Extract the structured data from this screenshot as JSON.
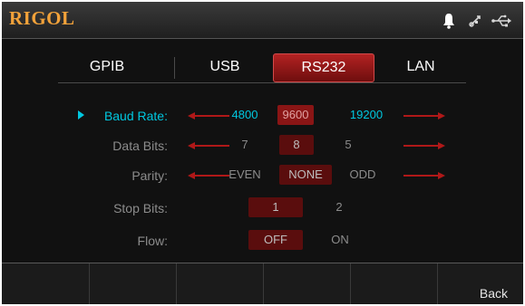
{
  "header": {
    "logo": "RIGOL",
    "icons": [
      "bell-icon",
      "usb-device-icon",
      "usb-icon"
    ]
  },
  "tabs": [
    {
      "label": "GPIB",
      "active": false
    },
    {
      "label": "USB",
      "active": false
    },
    {
      "label": "RS232",
      "active": true
    },
    {
      "label": "LAN",
      "active": false
    }
  ],
  "settings": {
    "baud_rate": {
      "label": "Baud Rate:",
      "options": [
        "4800",
        "9600",
        "19200"
      ],
      "selected": "9600"
    },
    "data_bits": {
      "label": "Data Bits:",
      "options": [
        "7",
        "8",
        "5"
      ],
      "selected": "8"
    },
    "parity": {
      "label": "Parity:",
      "options": [
        "EVEN",
        "NONE",
        "ODD"
      ],
      "selected": "NONE"
    },
    "stop_bits": {
      "label": "Stop Bits:",
      "options": [
        "1",
        "2"
      ],
      "selected": "1"
    },
    "flow": {
      "label": "Flow:",
      "options": [
        "OFF",
        "ON"
      ],
      "selected": "OFF"
    }
  },
  "softkeys": [
    "",
    "",
    "",
    "",
    "",
    "Back"
  ],
  "colors": {
    "logo": "#f2a23a",
    "accent_cyan": "#00c8e0",
    "selected_tab": "#b32222",
    "arrow": "#b01818"
  }
}
